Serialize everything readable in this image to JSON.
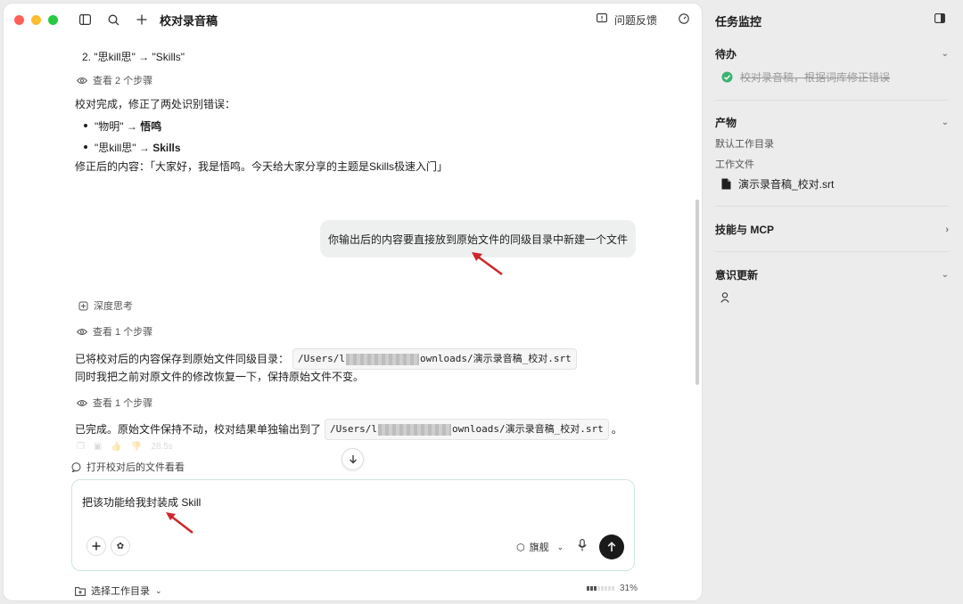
{
  "window": {
    "title": "校对录音稿",
    "feedback_label": "问题反馈"
  },
  "colors": {
    "red": "#ff5f57",
    "yellow": "#febc2e",
    "green": "#28c840",
    "accent_check": "#3bb273",
    "arrow": "#d0262b"
  },
  "chat": {
    "list_item_2": "2. \"思kill思\" → \"Skills\"",
    "steps_a": "查看 2 个步骤",
    "summary_intro": "校对完成，修正了两处识别错误：",
    "bullets": [
      {
        "from": "\"物明\" → ",
        "to": "悟鸣"
      },
      {
        "from": "\"思kill思\" → ",
        "to": "Skills"
      }
    ],
    "corrected": "修正后的内容：「大家好，我是悟鸣。今天给大家分享的主题是Skills极速入门」",
    "user_message": "你输出后的内容要直接放到原始文件的同级目录中新建一个文件",
    "deep_think": "深度思考",
    "steps_b": "查看 1 个步骤",
    "saved_prefix": "已将校对后的内容保存到原始文件同级目录：",
    "saved_path_start": "/Users/l",
    "saved_path_end": "ownloads/演示录音稿_校对.srt",
    "restore_note": "同时我把之前对原文件的修改恢复一下，保持原始文件不变。",
    "steps_c": "查看 1 个步骤",
    "done_prefix": "已完成。原始文件保持不动，校对结果单独输出到了",
    "done_path_start": "/Users/l",
    "done_path_end": "ownloads/演示录音稿_校对.srt",
    "done_suffix": "。",
    "elapsed": "28.5s",
    "open_file": "打开校对后的文件看看"
  },
  "composer": {
    "text": "把该功能给我封装成 Skill",
    "model": "旗舰",
    "workdir": "选择工作目录",
    "context_percent": "31%"
  },
  "panel": {
    "title": "任务监控",
    "todo_header": "待办",
    "todo_item": "校对录音稿，根据词库修正错误",
    "artifacts_header": "产物",
    "default_dir": "默认工作目录",
    "work_files": "工作文件",
    "file_name": "演示录音稿_校对.srt",
    "skills_header": "技能与 MCP",
    "memory_header": "意识更新"
  }
}
